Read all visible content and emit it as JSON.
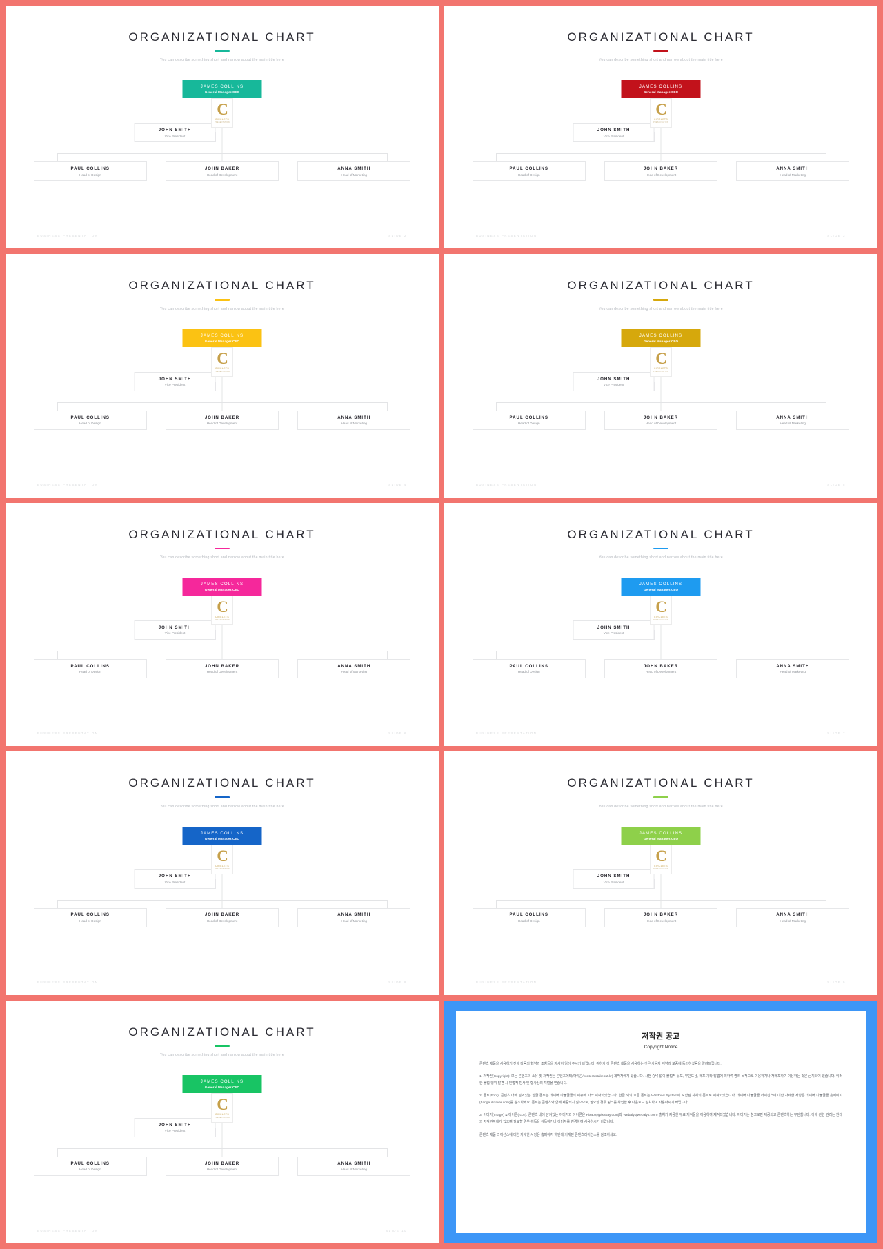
{
  "deck": {
    "title": "ORGANIZATIONAL CHART",
    "subtitle": "You can describe something short and narrow about the main title here",
    "footer_left": "BUSINESS PRESENTATION",
    "org": {
      "ceo": {
        "name": "JAMES COLLINS",
        "role": "General Manager/CEO"
      },
      "vp": {
        "name": "JOHN SMITH",
        "role": "Vice President"
      },
      "reports": [
        {
          "name": "PAUL COLLINS",
          "role": "Head of Design"
        },
        {
          "name": "JOHN BAKER",
          "role": "Head of Development"
        },
        {
          "name": "ANNA SMITH",
          "role": "Head of Marketing"
        }
      ]
    },
    "logo": {
      "mark": "C",
      "line1": "CIRCLETS",
      "line2": "PRESENTATION"
    }
  },
  "slides": [
    {
      "accent": "#17b89a",
      "footer_right": "SLIDE 2"
    },
    {
      "accent": "#c2121b",
      "footer_right": "SLIDE 3"
    },
    {
      "accent": "#fbc213",
      "footer_right": "SLIDE 4"
    },
    {
      "accent": "#d6a80c",
      "footer_right": "SLIDE 5"
    },
    {
      "accent": "#f5289b",
      "footer_right": "SLIDE 6"
    },
    {
      "accent": "#1e9bf0",
      "footer_right": "SLIDE 7"
    },
    {
      "accent": "#1565c8",
      "footer_right": "SLIDE 8"
    },
    {
      "accent": "#8ed04a",
      "footer_right": "SLIDE 9"
    },
    {
      "accent": "#18c464",
      "footer_right": "SLIDE 10"
    }
  ],
  "copyright": {
    "title_ko": "저작권 공고",
    "title_en": "Copyright Notice",
    "intro": "콘텐츠 제품을 사용하기 전에 다음의 협약과 조항들을 자세히 읽어 주시기 바랍니다. 귀하가 이 콘텐츠 제품을 사용하는 것은 사용자 계약과 보증에 동의하셨음을 알려드립니다.",
    "p1": "1. 저작권(Copyright): 모든 콘텐츠의 소유 및 저작권은 콘텐츠에터(아이콘/content/stakeout.kr) 제작자에게 있습니다. 사전 승낙 없이 불법적 유포, 무단도용, 배포 기타 방법에 의하여 영리 목적으로 이용하거나 재배포하여 이용하는 것은 금지되어 있습니다. 이러한 불법 행위 발견 시 민법적 민사 및 형사상의 처벌을 받습니다.",
    "p2": "2. 폰트(Font): 콘텐츠 내에 담겨있는 한글 폰트는 네이버 나눔글꼴의 제휴에 따라 저작되었습니다. 한글 외의 모든 폰트는 Windows System에 포함된 자체의 폰트로 제작되었습니다. 네이버 나눔글꼴 라이선스에 대한 자세한 사항은 네이버 나눔글꼴 홈페이지(hangeul.naver.com)를 참조하세요. 폰트는 콘텐츠와 함께 제공되지 않으므로, 필요할 경우 링크를 확인한 후 다운로드 설치하여 사용하시기 바랍니다.",
    "p3": "3. 이미지(Image) & 아이콘(Icon): 콘텐츠 내에 담겨있는 이미지와 아이콘은 Pixabay(pixabay.com)와 Webalys(webalys.com) 출처가 제공한 무료 저작물을 이용하여 제작되었습니다. 이미지는 참고로만 제공되고 콘텐츠하는 무단합니다. 이에 관한 권리는 원래의 저작권자에게 있으며 필요할 경우 취득을 취득하거나 이미지를 변경하여 사용하시기 바랍니다.",
    "outro": "콘텐츠 제품 라이선스에 대한 자세한 사항은 홈페이지 하단에 기재된 콘텐츠라이선스를 참조하세요."
  }
}
